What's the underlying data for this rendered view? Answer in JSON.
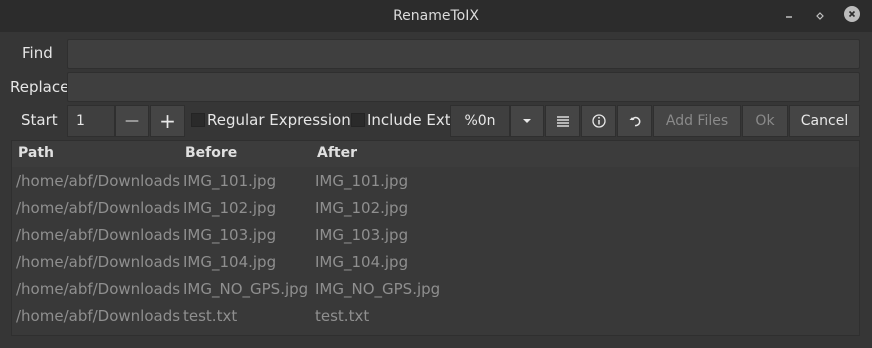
{
  "window": {
    "title": "RenameToIX"
  },
  "form": {
    "find_label": "Find",
    "find_value": "",
    "replace_label": "Replace",
    "replace_value": "",
    "start_label": "Start",
    "start_value": "1"
  },
  "toolbar": {
    "minus_label": "—",
    "plus_label": "+",
    "regex_label": "Regular Expression",
    "include_ext_label": "Include Ext",
    "pattern_label": "%0n",
    "add_files_label": "Add Files",
    "ok_label": "Ok",
    "cancel_label": "Cancel"
  },
  "table": {
    "headers": [
      "Path",
      "Before",
      "After"
    ],
    "rows": [
      [
        "/home/abf/Downloads",
        "IMG_101.jpg",
        "IMG_101.jpg"
      ],
      [
        "/home/abf/Downloads",
        "IMG_102.jpg",
        "IMG_102.jpg"
      ],
      [
        "/home/abf/Downloads",
        "IMG_103.jpg",
        "IMG_103.jpg"
      ],
      [
        "/home/abf/Downloads",
        "IMG_104.jpg",
        "IMG_104.jpg"
      ],
      [
        "/home/abf/Downloads",
        "IMG_NO_GPS.jpg",
        "IMG_NO_GPS.jpg"
      ],
      [
        "/home/abf/Downloads",
        "test.txt",
        "test.txt"
      ]
    ]
  },
  "icons": {
    "dropdown": "chevron-down-icon",
    "list": "list-icon",
    "info": "info-icon",
    "undo": "undo-icon"
  }
}
